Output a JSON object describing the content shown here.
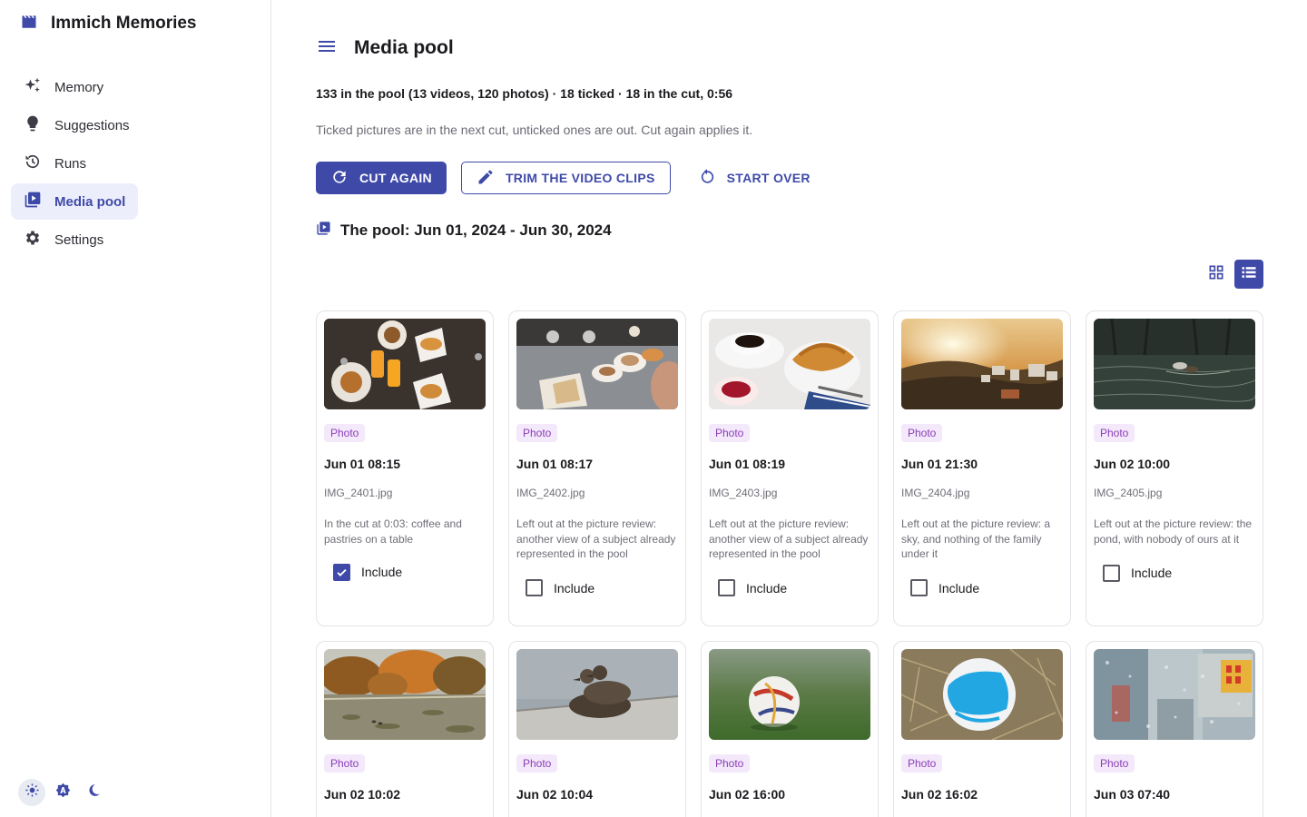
{
  "app": {
    "title": "Immich Memories",
    "logo_icon": "clapperboard-icon",
    "accent": "#3f4aa8"
  },
  "sidebar": {
    "items": [
      {
        "label": "Memory",
        "icon": "sparkles-icon",
        "active": false
      },
      {
        "label": "Suggestions",
        "icon": "lightbulb-icon",
        "active": false
      },
      {
        "label": "Runs",
        "icon": "history-icon",
        "active": false
      },
      {
        "label": "Media pool",
        "icon": "video-library-icon",
        "active": true
      },
      {
        "label": "Settings",
        "icon": "gear-icon",
        "active": false
      }
    ],
    "theme_modes": [
      "light",
      "auto",
      "dark"
    ],
    "theme_selected": "light"
  },
  "header": {
    "title": "Media pool",
    "menu_icon": "hamburger-menu-icon"
  },
  "summary": "133 in the pool (13 videos, 120 photos) · 18 ticked · 18 in the cut, 0:56",
  "hint": "Ticked pictures are in the next cut, unticked ones are out. Cut again applies it.",
  "actions": {
    "cut_again": "CUT AGAIN",
    "trim": "TRIM THE VIDEO CLIPS",
    "start_over": "START OVER"
  },
  "pool": {
    "title": "The pool: Jun 01, 2024 - Jun 30, 2024",
    "view_selected": "list"
  },
  "cards": [
    {
      "type": "Photo",
      "date": "Jun 01 08:15",
      "file": "IMG_2401.jpg",
      "note": "In the cut at 0:03: coffee and pastries on a table",
      "include_label": "Include",
      "checked": true
    },
    {
      "type": "Photo",
      "date": "Jun 01 08:17",
      "file": "IMG_2402.jpg",
      "note": "Left out at the picture review: another view of a subject already represented in the pool",
      "include_label": "Include",
      "checked": false
    },
    {
      "type": "Photo",
      "date": "Jun 01 08:19",
      "file": "IMG_2403.jpg",
      "note": "Left out at the picture review: another view of a subject already represented in the pool",
      "include_label": "Include",
      "checked": false
    },
    {
      "type": "Photo",
      "date": "Jun 01 21:30",
      "file": "IMG_2404.jpg",
      "note": "Left out at the picture review: a sky, and nothing of the family under it",
      "include_label": "Include",
      "checked": false
    },
    {
      "type": "Photo",
      "date": "Jun 02 10:00",
      "file": "IMG_2405.jpg",
      "note": "Left out at the picture review: the pond, with nobody of ours at it",
      "include_label": "Include",
      "checked": false
    },
    {
      "type": "Photo",
      "date": "Jun 02 10:02",
      "file": "",
      "note": "",
      "include_label": "",
      "checked": false
    },
    {
      "type": "Photo",
      "date": "Jun 02 10:04",
      "file": "",
      "note": "",
      "include_label": "",
      "checked": false
    },
    {
      "type": "Photo",
      "date": "Jun 02 16:00",
      "file": "",
      "note": "",
      "include_label": "",
      "checked": false
    },
    {
      "type": "Photo",
      "date": "Jun 02 16:02",
      "file": "",
      "note": "",
      "include_label": "",
      "checked": false
    },
    {
      "type": "Photo",
      "date": "Jun 03 07:40",
      "file": "",
      "note": "",
      "include_label": "",
      "checked": false
    }
  ]
}
